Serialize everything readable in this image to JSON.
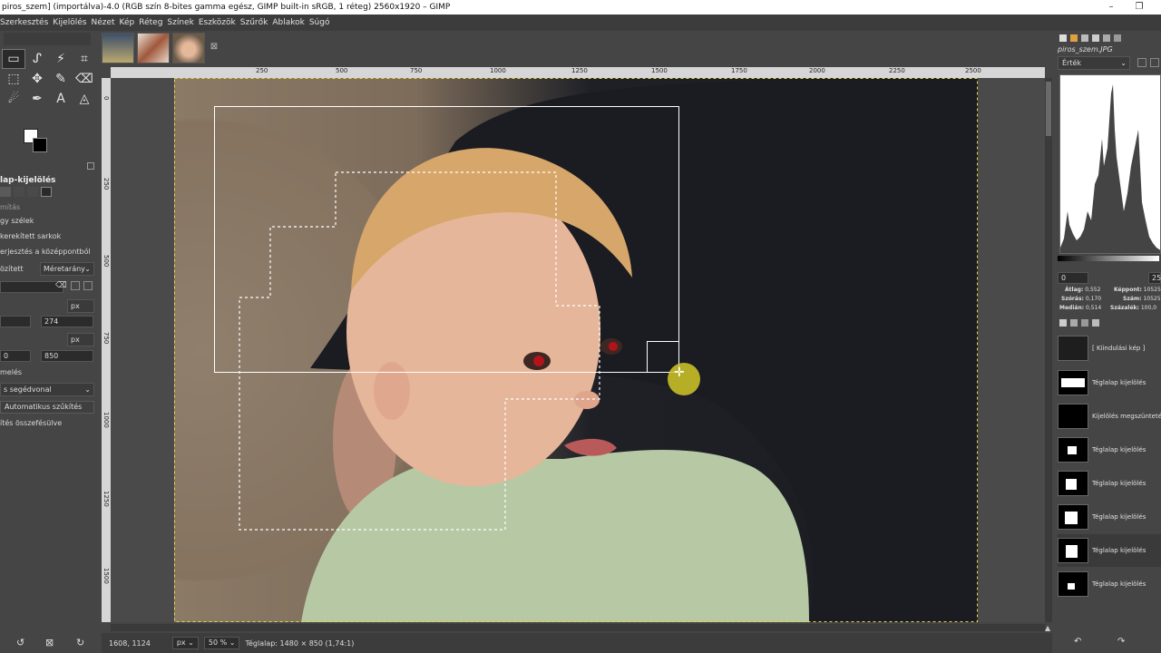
{
  "window": {
    "title": "piros_szem] (importálva)-4.0 (RGB szín 8-bites gamma egész, GIMP built-in sRGB, 1 réteg) 2560x1920 – GIMP",
    "minimize": "–",
    "restore": "❐"
  },
  "menu": [
    "Szerkesztés",
    "Kijelölés",
    "Nézet",
    "Kép",
    "Réteg",
    "Színek",
    "Eszközök",
    "Szűrők",
    "Ablakok",
    "Súgó"
  ],
  "tool_options": {
    "title": "lap-kijelölés",
    "mode_label": "mítás",
    "smooth_edges": "gy szélek",
    "rounded_corners": "kerekített sarkok",
    "expand_center": "erjesztés a középpontból",
    "fixed_label": "özített",
    "fixed_value": "Méretarány",
    "pos_unit": "px",
    "pos_x": "",
    "pos_y": "274",
    "size_unit": "px",
    "size_x": "0",
    "size_y": "850",
    "highlight": "melés",
    "guides_value": "s segédvonal",
    "auto_shrink": "Automatikus szűkítés",
    "merged": "ítés összefésülve"
  },
  "ruler": {
    "h_marks": [
      "250",
      "500",
      "750",
      "1000",
      "1250",
      "1500",
      "1750",
      "2000",
      "2250",
      "2500"
    ],
    "v_marks": [
      "0",
      "250",
      "500",
      "750",
      "1000",
      "1250",
      "1500",
      "1750"
    ]
  },
  "status": {
    "coords": "1608, 1124",
    "unit": "px",
    "zoom": "50 %",
    "message": "Téglalap: 1480 × 850  (1,74:1)"
  },
  "histogram": {
    "file": "piros_szem.JPG",
    "channel": "Érték",
    "range_min": "0",
    "range_max": "25",
    "stats_left": [
      {
        "label": "Átlag:",
        "value": "0,552"
      },
      {
        "label": "Szórás:",
        "value": "0,170"
      },
      {
        "label": "Medián:",
        "value": "0,514"
      }
    ],
    "stats_right": [
      {
        "label": "Képpont:",
        "value": "10525"
      },
      {
        "label": "Szám:",
        "value": "10525"
      },
      {
        "label": "Százalék:",
        "value": "100,0"
      }
    ]
  },
  "undo_history": [
    {
      "label": "[ Kiindulási kép ]"
    },
    {
      "label": "Téglalap kijelölés"
    },
    {
      "label": "Kijelölés megszüntetése"
    },
    {
      "label": "Téglalap kijelölés"
    },
    {
      "label": "Téglalap kijelölés"
    },
    {
      "label": "Téglalap kijelölés"
    },
    {
      "label": "Téglalap kijelölés"
    },
    {
      "label": "Téglalap kijelölés"
    }
  ],
  "colors": {
    "accent": "#d2c828",
    "selection": "#ffffff"
  }
}
